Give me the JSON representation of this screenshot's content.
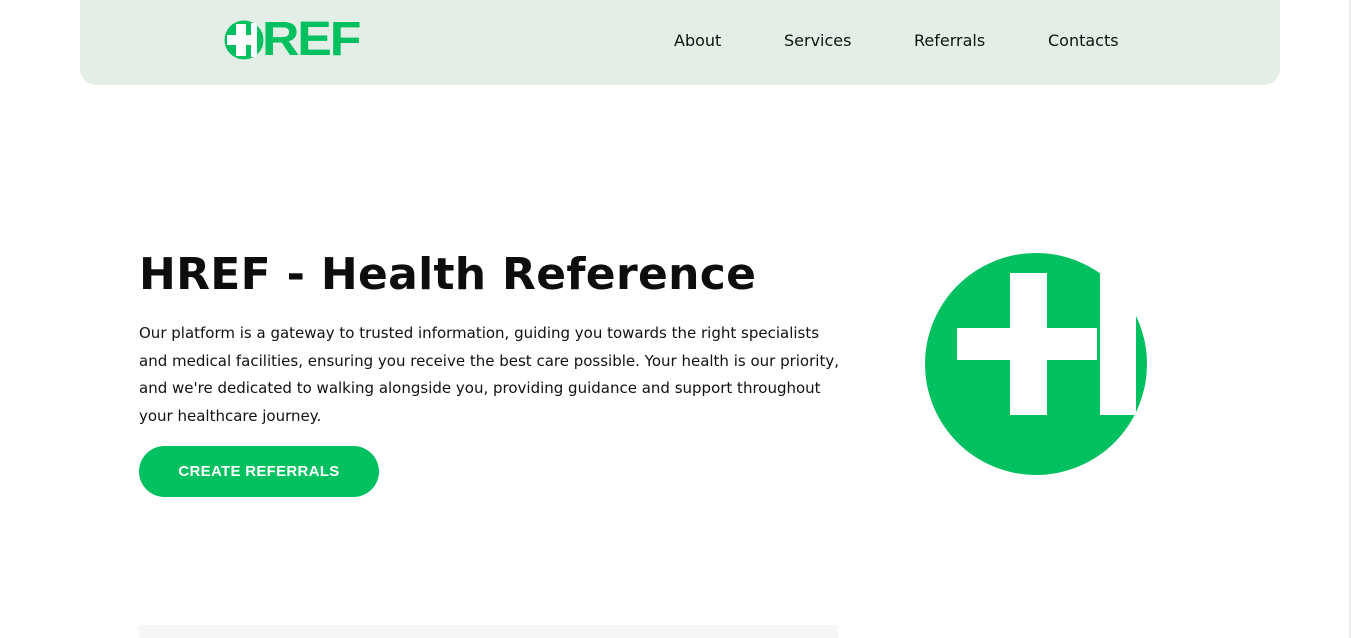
{
  "header": {
    "logo": {
      "text": "REF",
      "mark_icon": "plus-h-icon",
      "color": "#00c060"
    },
    "nav": {
      "about": "About",
      "services": "Services",
      "referrals": "Referrals",
      "contacts": "Contacts"
    },
    "background": "#e3efe6"
  },
  "hero": {
    "title": "HREF - Health Reference",
    "description": "Our platform is a gateway to trusted information, guiding you towards the right specialists and medical facilities, ensuring you receive the best care possible. Your health is our priority, and we're dedicated to walking alongside you, providing guidance and support throughout your healthcare journey.",
    "cta_label": "CREATE REFERRALS",
    "graphic_icon": "plus-h-icon"
  },
  "theme": {
    "accent": "#00c060",
    "text": "#111111",
    "background": "#ffffff"
  }
}
